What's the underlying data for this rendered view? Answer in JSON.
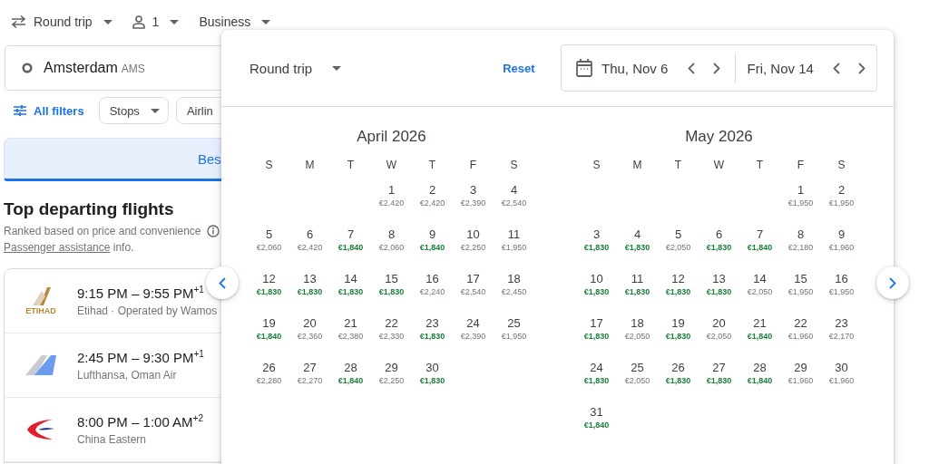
{
  "trip_bar": {
    "trip_type": "Round trip",
    "passengers": "1",
    "cabin": "Business"
  },
  "origin": {
    "city": "Amsterdam",
    "code": "AMS"
  },
  "filters": {
    "all_filters": "All filters",
    "chips": [
      "Stops",
      "Airlin"
    ]
  },
  "sort_tab": {
    "label": "Bes",
    "selected": true
  },
  "section": {
    "title": "Top departing flights",
    "subtitle": "Ranked based on price and convenience",
    "assistance_link": "Passenger assistance",
    "assistance_suffix": "info."
  },
  "flights": [
    {
      "kind": "etihad",
      "logo_text": "ETIHAD",
      "times": "9:15 PM – 9:55 PM",
      "day_offset": "+1",
      "airline": "Etihad · Operated by Wamos"
    },
    {
      "kind": "lufthansa",
      "times": "2:45 PM – 9:30 PM",
      "day_offset": "+1",
      "airline": "Lufthansa, Oman Air"
    },
    {
      "kind": "china-eastern",
      "times": "8:00 PM – 1:00 AM",
      "day_offset": "+2",
      "airline": "China Eastern"
    }
  ],
  "date_picker": {
    "trip_type": "Round trip",
    "reset": "Reset",
    "departure": "Thu, Nov 6",
    "return": "Fri, Nov 14",
    "months": [
      {
        "title": "April 2026",
        "weekdays": [
          "S",
          "M",
          "T",
          "W",
          "T",
          "F",
          "S"
        ],
        "weeks": [
          {
            "kind": "first",
            "days": [
              {
                "day": "1",
                "price": "€2,420",
                "cheap": false
              },
              {
                "day": "2",
                "price": "€2,420",
                "cheap": false
              },
              {
                "day": "3",
                "price": "€2,390",
                "cheap": false
              },
              {
                "day": "4",
                "price": "€2,540",
                "cheap": false
              }
            ]
          },
          {
            "kind": "rest",
            "days": [
              {
                "day": "5",
                "price": "€2,060",
                "cheap": false
              },
              {
                "day": "6",
                "price": "€2,420",
                "cheap": false
              },
              {
                "day": "7",
                "price": "€1,840",
                "cheap": true
              },
              {
                "day": "8",
                "price": "€2,060",
                "cheap": false
              },
              {
                "day": "9",
                "price": "€1,840",
                "cheap": true
              },
              {
                "day": "10",
                "price": "€2,250",
                "cheap": false
              },
              {
                "day": "11",
                "price": "€1,950",
                "cheap": false
              }
            ]
          },
          {
            "kind": "rest",
            "days": [
              {
                "day": "12",
                "price": "€1,830",
                "cheap": true
              },
              {
                "day": "13",
                "price": "€1,830",
                "cheap": true
              },
              {
                "day": "14",
                "price": "€1,830",
                "cheap": true
              },
              {
                "day": "15",
                "price": "€1,830",
                "cheap": true
              },
              {
                "day": "16",
                "price": "€2,240",
                "cheap": false
              },
              {
                "day": "17",
                "price": "€2,540",
                "cheap": false
              },
              {
                "day": "18",
                "price": "€2,450",
                "cheap": false
              }
            ]
          },
          {
            "kind": "rest",
            "days": [
              {
                "day": "19",
                "price": "€1,840",
                "cheap": true
              },
              {
                "day": "20",
                "price": "€2,360",
                "cheap": false
              },
              {
                "day": "21",
                "price": "€2,380",
                "cheap": false
              },
              {
                "day": "22",
                "price": "€2,330",
                "cheap": false
              },
              {
                "day": "23",
                "price": "€1,830",
                "cheap": true
              },
              {
                "day": "24",
                "price": "€2,390",
                "cheap": false
              },
              {
                "day": "25",
                "price": "€1,950",
                "cheap": false
              }
            ]
          },
          {
            "kind": "rest",
            "days": [
              {
                "day": "26",
                "price": "€2,280",
                "cheap": false
              },
              {
                "day": "27",
                "price": "€2,270",
                "cheap": false
              },
              {
                "day": "28",
                "price": "€1,840",
                "cheap": true
              },
              {
                "day": "29",
                "price": "€2,250",
                "cheap": false
              },
              {
                "day": "30",
                "price": "€1,830",
                "cheap": true
              }
            ]
          }
        ]
      },
      {
        "title": "May 2026",
        "weekdays": [
          "S",
          "M",
          "T",
          "W",
          "T",
          "F",
          "S"
        ],
        "weeks": [
          {
            "kind": "first",
            "days": [
              {
                "day": "1",
                "price": "€1,950",
                "cheap": false
              },
              {
                "day": "2",
                "price": "€1,950",
                "cheap": false
              }
            ]
          },
          {
            "kind": "rest",
            "days": [
              {
                "day": "3",
                "price": "€1,830",
                "cheap": true
              },
              {
                "day": "4",
                "price": "€1,830",
                "cheap": true
              },
              {
                "day": "5",
                "price": "€2,050",
                "cheap": false
              },
              {
                "day": "6",
                "price": "€1,830",
                "cheap": true
              },
              {
                "day": "7",
                "price": "€1,840",
                "cheap": true
              },
              {
                "day": "8",
                "price": "€2,180",
                "cheap": false
              },
              {
                "day": "9",
                "price": "€1,960",
                "cheap": false
              }
            ]
          },
          {
            "kind": "rest",
            "days": [
              {
                "day": "10",
                "price": "€1,830",
                "cheap": true
              },
              {
                "day": "11",
                "price": "€1,830",
                "cheap": true
              },
              {
                "day": "12",
                "price": "€1,830",
                "cheap": true
              },
              {
                "day": "13",
                "price": "€1,830",
                "cheap": true
              },
              {
                "day": "14",
                "price": "€2,050",
                "cheap": false
              },
              {
                "day": "15",
                "price": "€1,950",
                "cheap": false
              },
              {
                "day": "16",
                "price": "€1,950",
                "cheap": false
              }
            ]
          },
          {
            "kind": "rest",
            "days": [
              {
                "day": "17",
                "price": "€1,830",
                "cheap": true
              },
              {
                "day": "18",
                "price": "€2,050",
                "cheap": false
              },
              {
                "day": "19",
                "price": "€1,830",
                "cheap": true
              },
              {
                "day": "20",
                "price": "€2,050",
                "cheap": false
              },
              {
                "day": "21",
                "price": "€1,840",
                "cheap": true
              },
              {
                "day": "22",
                "price": "€1,960",
                "cheap": false
              },
              {
                "day": "23",
                "price": "€2,170",
                "cheap": false
              }
            ]
          },
          {
            "kind": "rest",
            "days": [
              {
                "day": "24",
                "price": "€1,830",
                "cheap": true
              },
              {
                "day": "25",
                "price": "€2,050",
                "cheap": false
              },
              {
                "day": "26",
                "price": "€1,830",
                "cheap": true
              },
              {
                "day": "27",
                "price": "€1,830",
                "cheap": true
              },
              {
                "day": "28",
                "price": "€1,840",
                "cheap": true
              },
              {
                "day": "29",
                "price": "€1,960",
                "cheap": false
              },
              {
                "day": "30",
                "price": "€1,960",
                "cheap": false
              }
            ]
          },
          {
            "kind": "rest",
            "days": [
              {
                "day": "31",
                "price": "€1,840",
                "cheap": true
              }
            ]
          }
        ]
      }
    ]
  }
}
